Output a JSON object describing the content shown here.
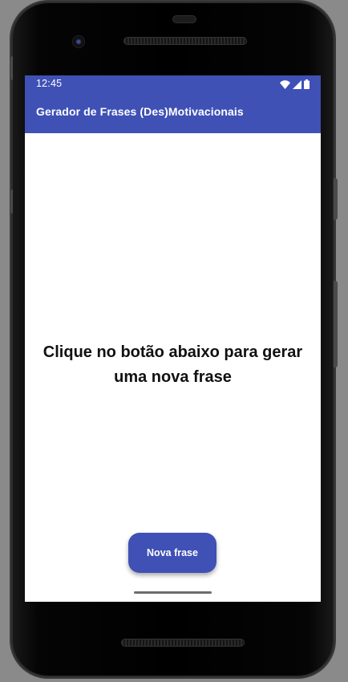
{
  "status_bar": {
    "time": "12:45",
    "icons": [
      "wifi-icon",
      "cell-signal-icon",
      "battery-icon"
    ]
  },
  "app_bar": {
    "title": "Gerador de Frases (Des)Motivacionais"
  },
  "main": {
    "phrase": "Clique no botão abaixo para gerar uma nova frase",
    "button_label": "Nova frase"
  },
  "colors": {
    "primary": "#3f51b5",
    "background": "#ffffff",
    "text": "#111111"
  }
}
